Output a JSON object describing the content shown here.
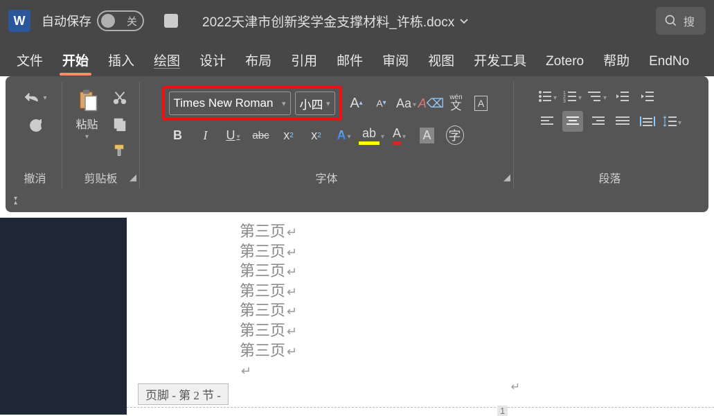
{
  "titlebar": {
    "autosave_label": "自动保存",
    "toggle_off_label": "关",
    "doc_title": "2022天津市创新奖学金支撑材料_许栋.docx",
    "search_placeholder": "搜"
  },
  "tabs": {
    "file": "文件",
    "home": "开始",
    "insert": "插入",
    "draw": "绘图",
    "design": "设计",
    "layout": "布局",
    "references": "引用",
    "mailings": "邮件",
    "review": "审阅",
    "view": "视图",
    "dev": "开发工具",
    "zotero": "Zotero",
    "help": "帮助",
    "endnote": "EndNo"
  },
  "ribbon": {
    "undo_group": "撤消",
    "clipboard_group": "剪贴板",
    "paste_label": "粘贴",
    "font_group": "字体",
    "paragraph_group": "段落",
    "font_name": "Times New Roman",
    "font_size": "小四",
    "aa_label": "Aa",
    "ruby_wen": "wén",
    "ruby_char": "文",
    "a_char": "A",
    "zi_char": "字",
    "sub_2": "2",
    "bold": "B",
    "italic": "I",
    "underline": "U",
    "strike": "abc",
    "sub_x": "x",
    "sup_x": "x"
  },
  "document": {
    "lines": [
      "第三页",
      "第三页",
      "第三页",
      "第三页",
      "第三页",
      "第三页",
      "第三页",
      ""
    ],
    "footer_label": "页脚 - 第 2 节 -",
    "page_num": "1"
  }
}
